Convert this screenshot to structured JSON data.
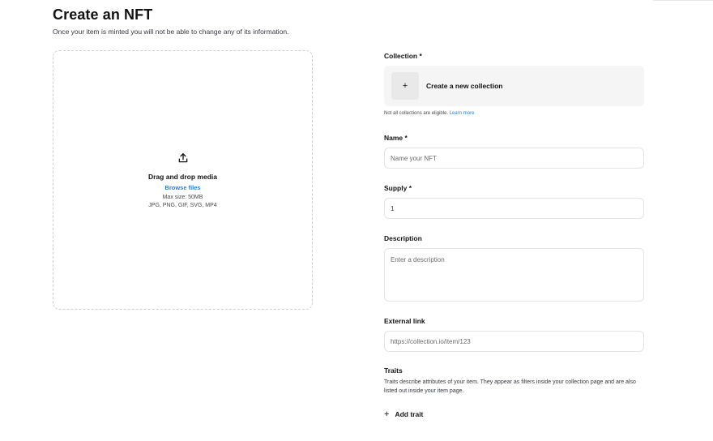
{
  "header": {
    "title": "Create an NFT",
    "subtitle": "Once your item is minted you will not be able to change any of its information."
  },
  "dropzone": {
    "title": "Drag and drop media",
    "browse_label": "Browse files",
    "max_size": "Max size: 50MB",
    "formats": "JPG, PNG, GIF, SVG, MP4",
    "icon": "upload-icon"
  },
  "form": {
    "collection": {
      "label": "Collection *",
      "create_label": "Create a new collection",
      "create_icon": "+",
      "hint_text": "Not all collections are eligible.",
      "hint_link": "Learn more"
    },
    "name": {
      "label": "Name *",
      "placeholder": "Name your NFT",
      "value": ""
    },
    "supply": {
      "label": "Supply *",
      "value": "1"
    },
    "description": {
      "label": "Description",
      "placeholder": "Enter a description",
      "value": ""
    },
    "external_link": {
      "label": "External link",
      "placeholder": "https://collection.io/item/123",
      "value": ""
    },
    "traits": {
      "label": "Traits",
      "description": "Traits describe attributes of your item. They appear as filters inside your collection page and are also listed out inside your item page.",
      "add_label": "Add trait",
      "add_icon": "+"
    }
  },
  "colors": {
    "link": "#2081e2",
    "card_bg": "#f5f5f5",
    "border": "#e4e4e4"
  }
}
